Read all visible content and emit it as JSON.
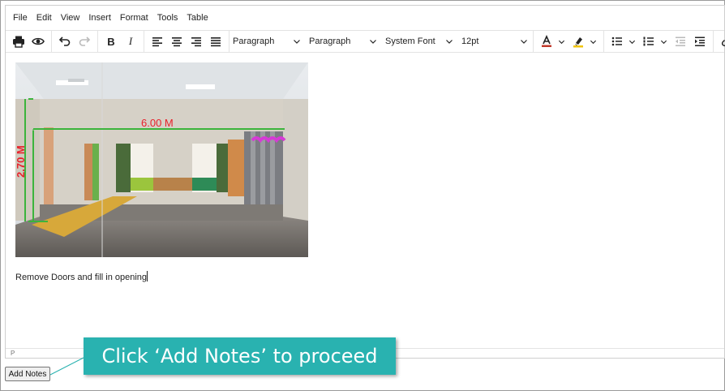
{
  "menubar": {
    "items": [
      "File",
      "Edit",
      "View",
      "Insert",
      "Format",
      "Tools",
      "Table"
    ]
  },
  "toolbar": {
    "bold": "B",
    "italic": "I",
    "block_format": "Paragraph",
    "style_format": "Paragraph",
    "font_family": "System Font",
    "font_size": "12pt",
    "text_color_icon": "text-color-icon",
    "highlight_color_icon": "highlight-icon",
    "accent_text_color": "#c0392b",
    "accent_highlight_color": "#f1c40f"
  },
  "content": {
    "image": {
      "width_label": "6.00 M",
      "height_label": "2.70 M",
      "annotation_color": "#e8212b",
      "guide_color": "#3cb43c"
    },
    "note": "Remove Doors and fill in opening"
  },
  "statusbar": {
    "path": "P"
  },
  "add_notes_button": "Add Notes",
  "callout": {
    "text": "Click ‘Add Notes’ to proceed",
    "color": "#29b2b0"
  }
}
